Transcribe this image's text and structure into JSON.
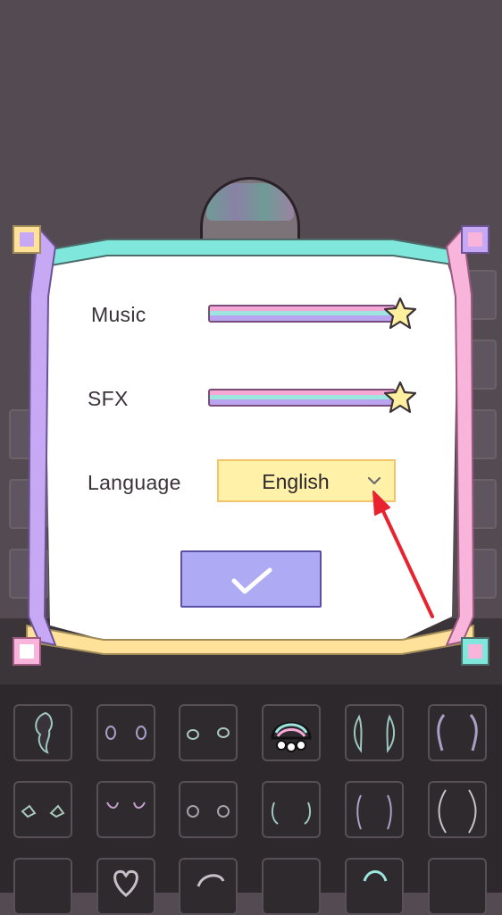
{
  "settings": {
    "music_label": "Music",
    "sfx_label": "SFX",
    "language_label": "Language",
    "language_value": "English",
    "music_level": 1.0,
    "sfx_level": 1.0
  },
  "icons": {
    "slider_knob": "star-icon",
    "dropdown_toggle": "chevron-down-icon",
    "confirm": "checkmark-icon"
  },
  "colors": {
    "dialog_fill": "#ffffff",
    "frame_top": "#7fe7dc",
    "frame_left": "#c7a8f5",
    "frame_right": "#f9b4dc",
    "frame_bottom": "#ffe19a",
    "dropdown_fill": "#fff1a8",
    "confirm_fill": "#aeaaf3",
    "annotation_arrow": "#e8232f"
  }
}
